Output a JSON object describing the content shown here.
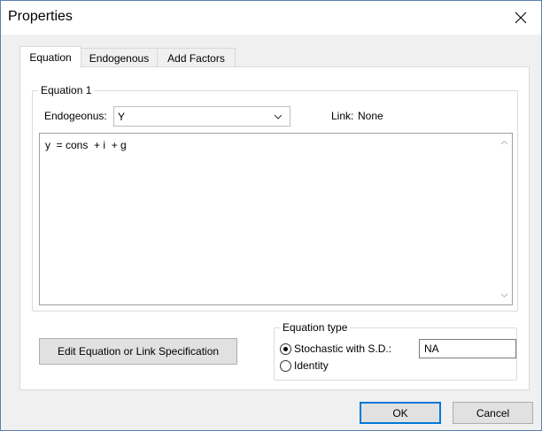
{
  "window": {
    "title": "Properties"
  },
  "tabs": [
    {
      "label": "Equation",
      "active": true
    },
    {
      "label": "Endogenous",
      "active": false
    },
    {
      "label": "Add Factors",
      "active": false
    }
  ],
  "equation_group": {
    "legend": "Equation 1",
    "endogenous_label": "Endogeonus:",
    "endogenous_value": "Y",
    "link_label": "Link:",
    "link_value": "None",
    "equation_text": "y  = cons  + i  + g"
  },
  "edit_button": {
    "label": "Edit Equation or Link Specification"
  },
  "equation_type": {
    "legend": "Equation type",
    "stochastic_label": "Stochastic with S.D.:",
    "stochastic_selected": true,
    "sd_value": "NA",
    "identity_label": "Identity"
  },
  "buttons": {
    "ok": "OK",
    "cancel": "Cancel"
  }
}
